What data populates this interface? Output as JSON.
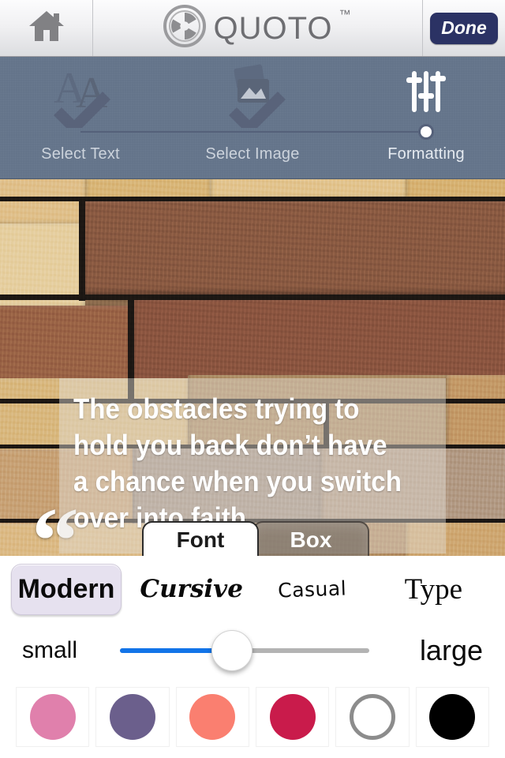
{
  "header": {
    "home_icon": "home-icon",
    "brand_icon": "aperture-logo-icon",
    "brand": "QUOTO",
    "trademark": "™",
    "done_label": "Done"
  },
  "steps": {
    "items": [
      {
        "label": "Select Text",
        "icon": "text-check-icon",
        "state": "complete"
      },
      {
        "label": "Select Image",
        "icon": "image-check-icon",
        "state": "complete"
      },
      {
        "label": "Formatting",
        "icon": "sliders-icon",
        "state": "current"
      }
    ]
  },
  "canvas": {
    "open_quote": "“",
    "close_quote": "”",
    "quote_text": "The obstacles trying to hold you back don’t have a chance when you switch over into faith",
    "overlay_color": "#e2ded8"
  },
  "tabs": {
    "items": [
      {
        "label": "Font",
        "active": true
      },
      {
        "label": "Box",
        "active": false
      }
    ]
  },
  "fonts": {
    "options": [
      {
        "label": "Modern",
        "selected": true
      },
      {
        "label": "Cursive",
        "selected": false
      },
      {
        "label": "Casual",
        "selected": false
      },
      {
        "label": "Type",
        "selected": false
      }
    ],
    "selected_bg": "#e6e1ef"
  },
  "size_slider": {
    "min_label": "small",
    "max_label": "large",
    "value_percent": 45,
    "fill_color": "#1274e8",
    "track_color": "#b3b3b3"
  },
  "colors": {
    "swatches": [
      {
        "name": "pink",
        "hex": "#e080ac",
        "selected": false
      },
      {
        "name": "purple",
        "hex": "#6b5f8c",
        "selected": false
      },
      {
        "name": "coral",
        "hex": "#fa7f70",
        "selected": false
      },
      {
        "name": "crimson",
        "hex": "#c91b4b",
        "selected": false
      },
      {
        "name": "white",
        "hex": "#ffffff",
        "selected": false
      },
      {
        "name": "black",
        "hex": "#000000",
        "selected": false
      }
    ]
  }
}
